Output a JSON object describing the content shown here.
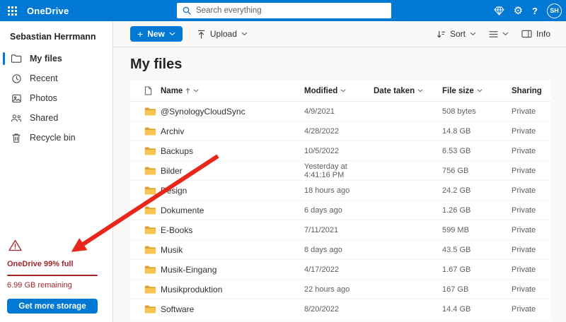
{
  "header": {
    "app_name": "OneDrive",
    "search_placeholder": "Search everything",
    "avatar_initials": "SH"
  },
  "sidebar": {
    "user_name": "Sebastian Herrmann",
    "items": [
      {
        "label": "My files",
        "selected": true
      },
      {
        "label": "Recent",
        "selected": false
      },
      {
        "label": "Photos",
        "selected": false
      },
      {
        "label": "Shared",
        "selected": false
      },
      {
        "label": "Recycle bin",
        "selected": false
      }
    ],
    "storage_warning": {
      "title": "OneDrive 99% full",
      "remaining": "6.99 GB remaining",
      "button_label": "Get more storage"
    }
  },
  "toolbar": {
    "new_label": "New",
    "upload_label": "Upload",
    "sort_label": "Sort",
    "info_label": "Info"
  },
  "main": {
    "title": "My files",
    "table": {
      "columns": {
        "name": "Name",
        "modified": "Modified",
        "date_taken": "Date taken",
        "file_size": "File size",
        "sharing": "Sharing"
      },
      "rows": [
        {
          "name": "@SynologyCloudSync",
          "modified": "4/9/2021",
          "date_taken": "",
          "file_size": "508 bytes",
          "sharing": "Private"
        },
        {
          "name": "Archiv",
          "modified": "4/28/2022",
          "date_taken": "",
          "file_size": "14.8 GB",
          "sharing": "Private"
        },
        {
          "name": "Backups",
          "modified": "10/5/2022",
          "date_taken": "",
          "file_size": "6.53 GB",
          "sharing": "Private"
        },
        {
          "name": "Bilder",
          "modified": "Yesterday at 4:41:16 PM",
          "date_taken": "",
          "file_size": "756 GB",
          "sharing": "Private"
        },
        {
          "name": "Design",
          "modified": "18 hours ago",
          "date_taken": "",
          "file_size": "24.2 GB",
          "sharing": "Private"
        },
        {
          "name": "Dokumente",
          "modified": "6 days ago",
          "date_taken": "",
          "file_size": "1.26 GB",
          "sharing": "Private"
        },
        {
          "name": "E-Books",
          "modified": "7/11/2021",
          "date_taken": "",
          "file_size": "599 MB",
          "sharing": "Private"
        },
        {
          "name": "Musik",
          "modified": "8 days ago",
          "date_taken": "",
          "file_size": "43.5 GB",
          "sharing": "Private"
        },
        {
          "name": "Musik-Eingang",
          "modified": "4/17/2022",
          "date_taken": "",
          "file_size": "1.67 GB",
          "sharing": "Private"
        },
        {
          "name": "Musikproduktion",
          "modified": "22 hours ago",
          "date_taken": "",
          "file_size": "167 GB",
          "sharing": "Private"
        },
        {
          "name": "Software",
          "modified": "8/20/2022",
          "date_taken": "",
          "file_size": "14.4 GB",
          "sharing": "Private"
        }
      ]
    }
  },
  "colors": {
    "accent_blue": "#0078d4",
    "warning_red": "#a4262c",
    "arrow_red": "#e8261a",
    "folder_yellow": "#f9c552"
  }
}
